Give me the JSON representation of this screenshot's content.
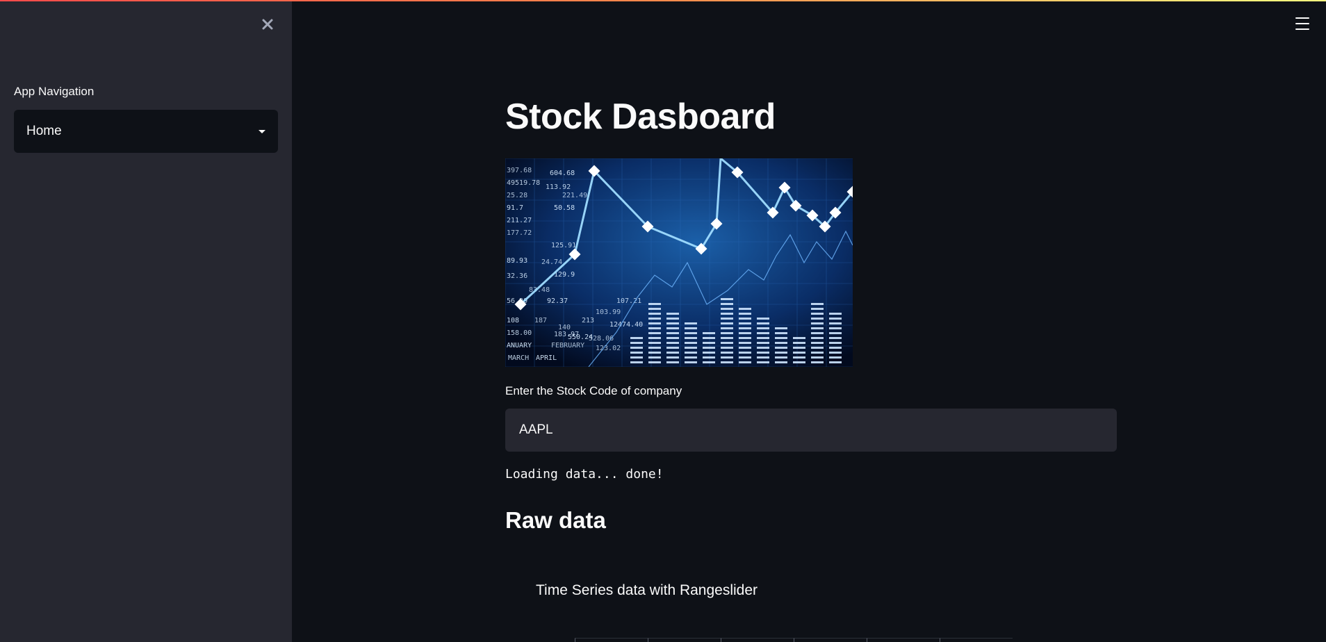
{
  "sidebar": {
    "nav_label": "App Navigation",
    "nav_selected": "Home"
  },
  "main": {
    "title": "Stock Dasboard",
    "stock_input_label": "Enter the Stock Code of company",
    "stock_input_value": "AAPL",
    "status": "Loading data... done!",
    "raw_data_heading": "Raw data",
    "chart_title": "Time Series data with Rangeslider"
  },
  "image_numbers": [
    "397.68",
    "49519.78",
    "604.68",
    "25.28",
    "113.92",
    "91.7",
    "221.49",
    "211.27",
    "50.58",
    "177.72",
    "125.91",
    "89.93",
    "24.74",
    "32.36",
    "129.9",
    "83.48",
    "56.29",
    "92.37",
    "103.99",
    "107.21",
    "108",
    "187",
    "213",
    "12474.40",
    "140",
    "158.00",
    "ANUARY",
    "FEBRUARY",
    "MARCH",
    "APRIL",
    "123.02",
    "183.97",
    "550.24",
    "528.06"
  ],
  "colors": {
    "background": "#0e1117",
    "sidebar": "#262730",
    "input_bg": "#262730",
    "text": "#fafafa",
    "accent_line": "#7fd1ff"
  }
}
